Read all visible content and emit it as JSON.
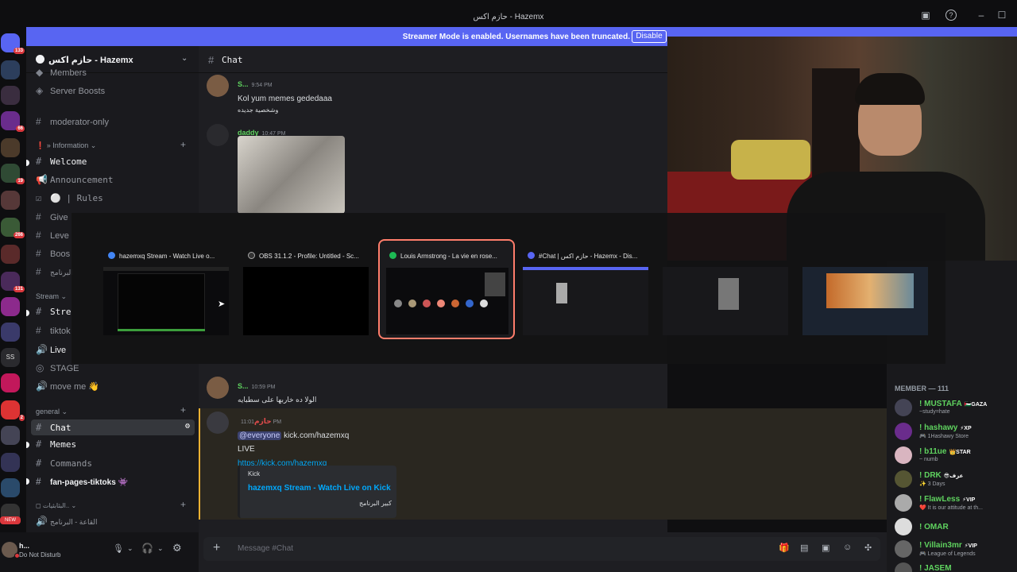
{
  "window": {
    "title": "حازم اكس - Hazemx"
  },
  "banner": {
    "text": "Streamer Mode is enabled. Usernames have been truncated.",
    "button": "Disable"
  },
  "server_badges": [
    "133",
    "66",
    "19",
    "266",
    "131",
    "SS",
    "2",
    "NEW"
  ],
  "guild": {
    "name": "حازم اكس - Hazemx"
  },
  "channels": {
    "partial_top": "Members",
    "server_boosts": "Server Boosts",
    "moderator_only": "moderator-only",
    "cat_information": "» Information",
    "welcome": "Welcome",
    "announcement": "Announcement",
    "rules": "| Rules",
    "give": "Give",
    "leve": "Leve",
    "boos": "Boos",
    "arabic_prog": "البرنامج",
    "cat_stream": "Stream",
    "stre": "Stre",
    "tiktok": "tiktok",
    "live": "Live",
    "stage": "STAGE",
    "move_me": "move me 👋",
    "cat_general": "general",
    "chat": "Chat",
    "memes": "Memes",
    "commands": "Commands",
    "fan_pages": "fan-pages-tiktoks 👾",
    "cat_arabic": "البثابثيات..",
    "arabic_hall": "القاعة - البرنامج"
  },
  "user_panel": {
    "name": "h...",
    "status": "Do Not Disturb"
  },
  "chat": {
    "header": "Chat",
    "messages": [
      {
        "author": "S...",
        "time": "9:54 PM",
        "lines": [
          "Kol yum memes gededaaa",
          "وشخصية جديده"
        ]
      },
      {
        "author": "daddy",
        "time": "10:47 PM"
      },
      {
        "author": "S...",
        "time": "10:59 PM",
        "lines": [
          "الولا ده خاربها على سطبايه"
        ]
      },
      {
        "author": "حازم",
        "time": "11:01 PM",
        "mention": "@everyone",
        "text": "kick.com/hazemxq",
        "line2": "LIVE",
        "link": "https://kick.com/hazemxq",
        "embed": {
          "provider": "Kick",
          "title": "hazemxq Stream - Watch Live on Kick",
          "desc": "كبير البرنامج"
        }
      }
    ],
    "composer_placeholder": "Message #Chat"
  },
  "alttab": {
    "tiles": [
      {
        "title": "hazemxq Stream - Watch Live o..."
      },
      {
        "title": "OBS 31.1.2 - Profile: Untitled - Sc..."
      },
      {
        "title": "Louis Armstrong - La vie en rose..."
      },
      {
        "title": "#Chat | حازم اكس - Hazemx - Dis..."
      },
      {
        "title": ""
      },
      {
        "title": ""
      }
    ]
  },
  "members": {
    "header": "MEMBER — 111",
    "list": [
      {
        "name": "! MUSTAFA",
        "tag": "🇵🇸GAZA",
        "status": "~study=hate",
        "color": "#43b581"
      },
      {
        "name": "! hashawy",
        "tag": "⚡XP",
        "status": "🎮 1Hashawy Store",
        "color": "#5fd35f"
      },
      {
        "name": "! b11ue",
        "tag": "👑STAR",
        "status": "~ numb",
        "color": "#5fd35f"
      },
      {
        "name": "! DRK",
        "tag": "😎عزف",
        "status": "✨ 3 Days",
        "color": "#5fd35f"
      },
      {
        "name": "! FlawLess",
        "tag": "⚡VIP",
        "status": "❤️ It is our attitude at th...",
        "color": "#5fd35f"
      },
      {
        "name": "! OMAR",
        "tag": "",
        "status": "",
        "color": "#5fd35f"
      },
      {
        "name": "! Villain3mr",
        "tag": "⚡VIP",
        "status": "🎮 League of Legends",
        "color": "#5fd35f"
      },
      {
        "name": "! JASEM",
        "tag": "",
        "status": "",
        "color": "#5fd35f"
      }
    ]
  }
}
